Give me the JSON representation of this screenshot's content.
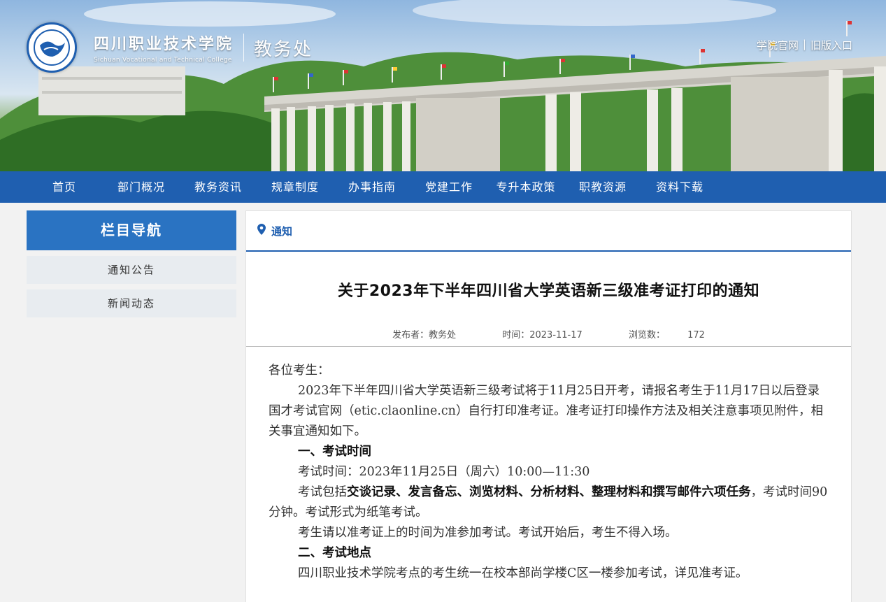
{
  "header": {
    "school_cn": "四川职业技术学院",
    "school_en": "Sichuan Vocational and Technical College",
    "dept": "教务处",
    "links": [
      "学院官网",
      "旧版入口"
    ],
    "separator": "|"
  },
  "nav": {
    "items": [
      "首页",
      "部门概况",
      "教务资讯",
      "规章制度",
      "办事指南",
      "党建工作",
      "专升本政策",
      "职教资源",
      "资料下载"
    ]
  },
  "sidebar": {
    "title": "栏目导航",
    "items": [
      "通知公告",
      "新闻动态"
    ]
  },
  "breadcrumb": {
    "label": "通知"
  },
  "article": {
    "title": "关于2023年下半年四川省大学英语新三级准考证打印的通知",
    "publisher": "发布者：教务处",
    "time": "时间：2023-11-17",
    "views_label": "浏览数：",
    "views": "172",
    "greeting": "各位考生：",
    "p1": "2023年下半年四川省大学英语新三级考试将于11月25日开考，请报名考生于11月17日以后登录国才考试官网（etic.claonline.cn）自行打印准考证。准考证打印操作方法及相关注意事项见附件，相关事宜通知如下。",
    "h1": "一、考试时间",
    "p2": "考试时间：2023年11月25日（周六）10:00—11:30",
    "p3_pre": "考试包括",
    "p3_bold": "交谈记录、发言备忘、浏览材料、分析材料、整理材料和撰写邮件六项任务",
    "p3_post": "，考试时间90分钟。考试形式为纸笔考试。",
    "p4": "考生请以准考证上的时间为准参加考试。考试开始后，考生不得入场。",
    "h2": "二、考试地点",
    "p5": "四川职业技术学院考点的考生统一在校本部尚学楼C区一楼参加考试，详见准考证。"
  },
  "colors": {
    "primary": "#1f5fb0",
    "sidebar_head": "#2a73c2",
    "sidebar_item_bg": "#e8ecf0"
  }
}
